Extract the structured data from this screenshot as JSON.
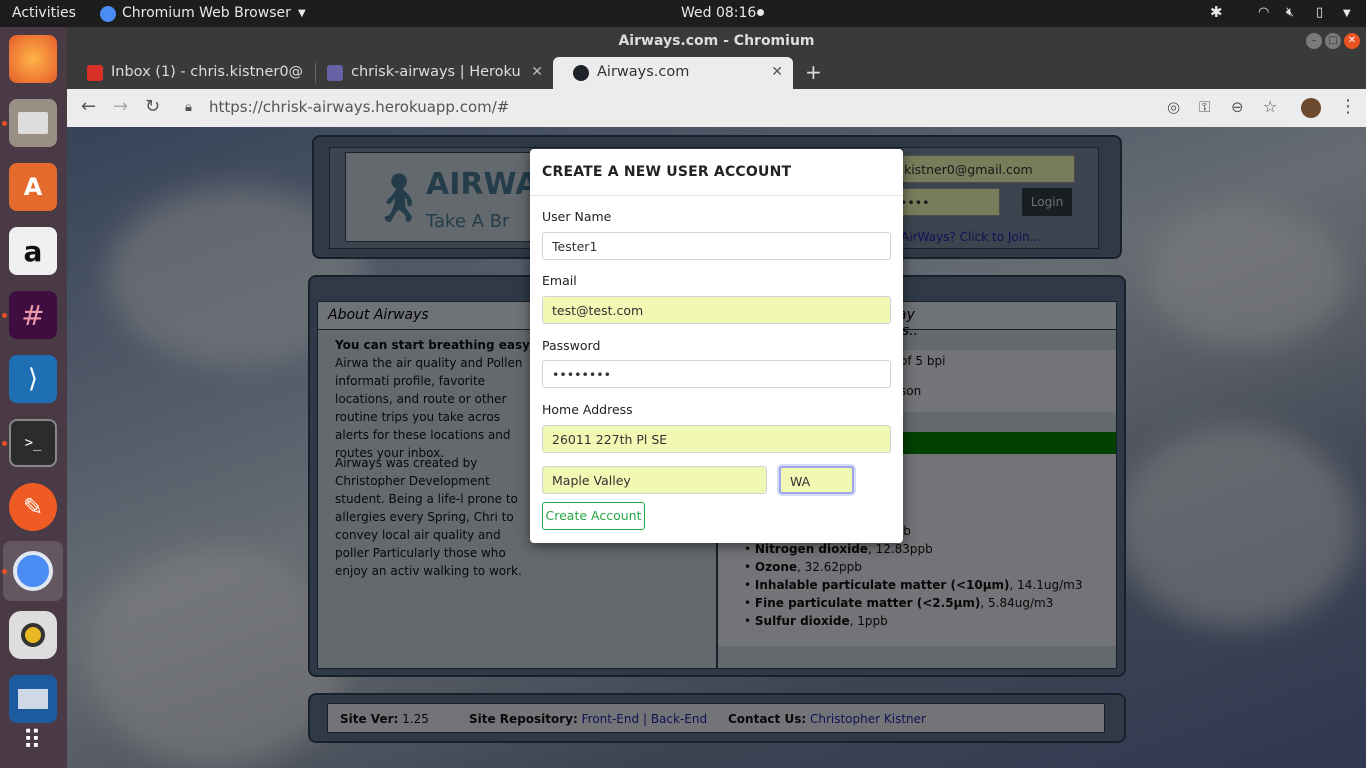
{
  "topbar": {
    "activities": "Activities",
    "app": "Chromium Web Browser",
    "clock": "Wed 08:16"
  },
  "window": {
    "title": "Airways.com - Chromium"
  },
  "tabs": [
    {
      "label": "Inbox (1) - chris.kistner0@",
      "icon": "gmail-icon"
    },
    {
      "label": "chrisk-airways | Heroku",
      "icon": "heroku-icon"
    },
    {
      "label": "Airways.com",
      "icon": "react-icon"
    }
  ],
  "address": {
    "url": "https://chrisk-airways.herokuapp.com/#"
  },
  "site": {
    "logo_title": "AIRWAYS",
    "logo_tagline": "Take A Br",
    "login_email": ".kistner0@gmail.com",
    "login_password": "••••",
    "login_button": "Login",
    "join_link": "o AirWays? Click to Join...",
    "about_title": "About Airways",
    "about_lead": "You can start breathing easy.",
    "about_p1": "Airwa the air quality and Pollen informati profile, favorite locations, and route or other routine trips you take acros alerts for these locations and routes your inbox.",
    "about_p2": "Airways was created by Christopher Development student. Being a life-l prone to allergies every Spring, Chri to convey local air quality and poller Particularly those who enjoy an activ walking to work.",
    "today_title": "ay is..",
    "pollen_line1": "of 5 bpi",
    "pollen_line2": "son",
    "pollutants": [
      {
        "name": "",
        "value": "ppb"
      },
      {
        "name": "Nitrogen dioxide",
        "value": ", 12.83ppb"
      },
      {
        "name": "Ozone",
        "value": ", 32.62ppb"
      },
      {
        "name": "Inhalable particulate matter (<10µm)",
        "value": ", 14.1ug/m3"
      },
      {
        "name": "Fine particulate matter (<2.5µm)",
        "value": ", 5.84ug/m3"
      },
      {
        "name": "Sulfur dioxide",
        "value": ", 1ppb"
      }
    ],
    "footer": {
      "ver_label": "Site Ver:",
      "ver": "1.25",
      "repo_label": "Site Repository:",
      "front": "Front-End",
      "sep": "|",
      "back": "Back-End",
      "contact_label": "Contact Us:",
      "contact": "Christopher Kistner"
    }
  },
  "modal": {
    "title": "CREATE A NEW USER ACCOUNT",
    "username_label": "User Name",
    "username": "Tester1",
    "email_label": "Email",
    "email": "test@test.com",
    "password_label": "Password",
    "password": "••••••••",
    "address_label": "Home Address",
    "street": "26011 227th Pl SE",
    "city": "Maple Valley",
    "state": "WA",
    "submit": "Create Account"
  },
  "colors": {
    "accent": "#28a745",
    "autofill": "#f1f8b4",
    "good_air": "#008000"
  }
}
